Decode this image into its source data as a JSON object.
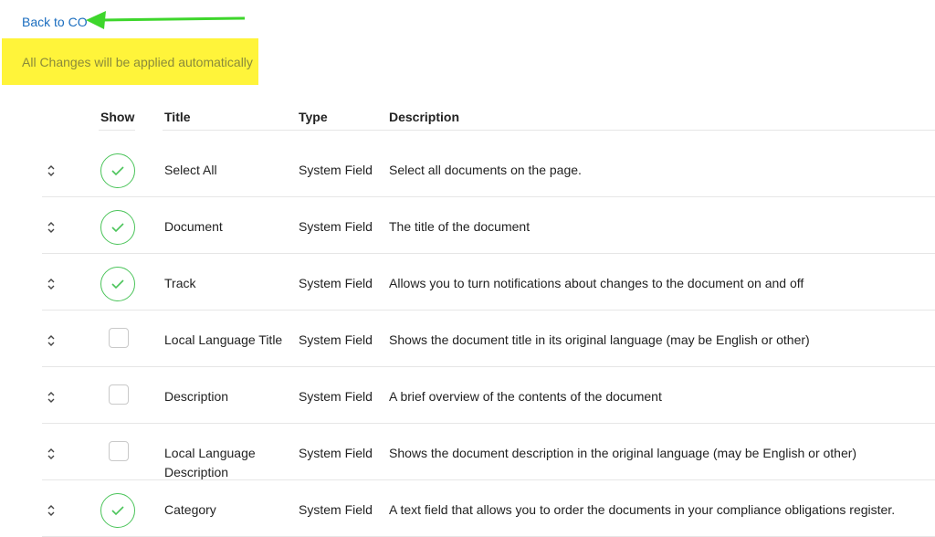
{
  "back_link": "Back to CO",
  "notice": "All Changes will be applied automatically",
  "columns": {
    "show": "Show",
    "title": "Title",
    "type": "Type",
    "description": "Description"
  },
  "colors": {
    "link": "#1a6dbf",
    "highlight": "#fff43a",
    "arrow": "#3ed62c",
    "check": "#4bc45a"
  },
  "rows": [
    {
      "shown": true,
      "title": "Select All",
      "type": "System Field",
      "description": "Select all documents on the page."
    },
    {
      "shown": true,
      "title": "Document",
      "type": "System Field",
      "description": "The title of the document"
    },
    {
      "shown": true,
      "title": "Track",
      "type": "System Field",
      "description": "Allows you to turn notifications about changes to the document on and off"
    },
    {
      "shown": false,
      "title": "Local Language Title",
      "type": "System Field",
      "description": "Shows the document title in its original language (may be English or other)"
    },
    {
      "shown": false,
      "title": "Description",
      "type": "System Field",
      "description": "A brief overview of the contents of the document"
    },
    {
      "shown": false,
      "title": "Local Language Description",
      "type": "System Field",
      "description": "Shows the document description in the original language (may be English or other)"
    },
    {
      "shown": true,
      "title": "Category",
      "type": "System Field",
      "description": "A text field that allows you to order the documents in your compliance obligations register."
    }
  ]
}
